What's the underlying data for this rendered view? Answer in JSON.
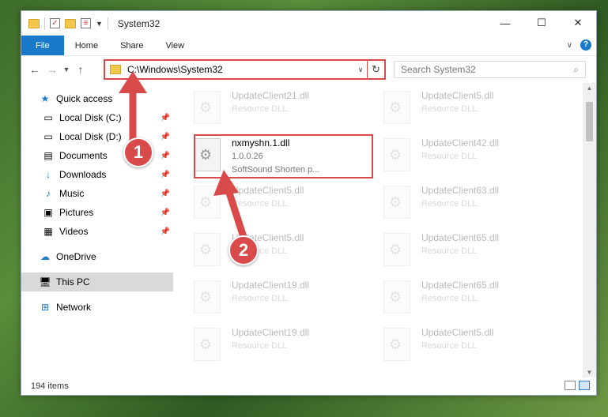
{
  "window": {
    "title": "System32",
    "controls": {
      "minimize": "—",
      "maximize": "☐",
      "close": "✕"
    }
  },
  "ribbon": {
    "tabs": [
      "File",
      "Home",
      "Share",
      "View"
    ]
  },
  "address": {
    "path": "C:\\Windows\\System32",
    "search_placeholder": "Search System32"
  },
  "nav": {
    "items": [
      {
        "label": "Quick access",
        "icon": "star-icon"
      },
      {
        "label": "Local Disk (C:)",
        "icon": "drive-icon",
        "pinned": true
      },
      {
        "label": "Local Disk (D:)",
        "icon": "drive-icon",
        "pinned": true
      },
      {
        "label": "Documents",
        "icon": "documents-icon",
        "pinned": true
      },
      {
        "label": "Downloads",
        "icon": "downloads-icon",
        "pinned": true
      },
      {
        "label": "Music",
        "icon": "music-icon",
        "pinned": true
      },
      {
        "label": "Pictures",
        "icon": "pictures-icon",
        "pinned": true
      },
      {
        "label": "Videos",
        "icon": "videos-icon",
        "pinned": true
      },
      {
        "label": "OneDrive",
        "icon": "cloud-icon"
      },
      {
        "label": "This PC",
        "icon": "computer-icon"
      },
      {
        "label": "Network",
        "icon": "network-icon"
      }
    ]
  },
  "files": {
    "left": [
      {
        "name": "UpdateClient21.dll",
        "sub": "Resource DLL"
      },
      {
        "name": "nxmyshn.1.dll",
        "sub": "1.0.0.26",
        "sub2": "SoftSound Shorten p..."
      },
      {
        "name": "UpdateClient5.dll",
        "sub": "Resource DLL"
      },
      {
        "name": "UpdateClient5.dll",
        "sub": "Resource DLL"
      },
      {
        "name": "UpdateClient19.dll",
        "sub": "Resource DLL"
      },
      {
        "name": "UpdateClient19.dll",
        "sub": "Resource DLL"
      }
    ],
    "right": [
      {
        "name": "UpdateClient5.dll",
        "sub": "Resource DLL"
      },
      {
        "name": "UpdateClient42.dll",
        "sub": "Resource DLL"
      },
      {
        "name": "UpdateClient63.dll",
        "sub": "Resource DLL"
      },
      {
        "name": "UpdateClient65.dll",
        "sub": "Resource DLL"
      },
      {
        "name": "UpdateClient65.dll",
        "sub": "Resource DLL"
      },
      {
        "name": "UpdateClient5.dll",
        "sub": "Resource DLL"
      }
    ]
  },
  "status": {
    "count": "194 items"
  },
  "callouts": [
    "1",
    "2"
  ],
  "colors": {
    "accent": "#1979ca",
    "highlight": "#d94b4b"
  }
}
